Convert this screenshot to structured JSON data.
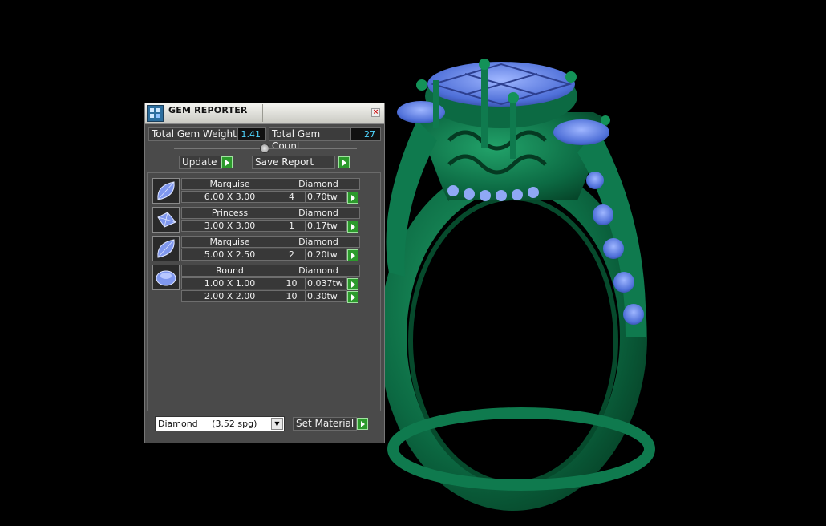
{
  "panel": {
    "title": "GEM REPORTER",
    "close_label": "×",
    "total_gem_weight_label": "Total Gem Weight",
    "total_gem_weight_value": "1.41",
    "total_gem_count_label": "Total Gem Count",
    "total_gem_count_value": "27",
    "update_label": "Update",
    "save_report_label": "Save Report",
    "gems": [
      {
        "shape": "Marquise",
        "material": "Diamond",
        "rows": [
          {
            "size": "6.00 X 3.00",
            "count": "4",
            "weight": "0.70tw"
          }
        ]
      },
      {
        "shape": "Princess",
        "material": "Diamond",
        "rows": [
          {
            "size": "3.00 X 3.00",
            "count": "1",
            "weight": "0.17tw"
          }
        ]
      },
      {
        "shape": "Marquise",
        "material": "Diamond",
        "rows": [
          {
            "size": "5.00 X 2.50",
            "count": "2",
            "weight": "0.20tw"
          }
        ]
      },
      {
        "shape": "Round",
        "material": "Diamond",
        "rows": [
          {
            "size": "1.00 X 1.00",
            "count": "10",
            "weight": "0.037tw"
          },
          {
            "size": "2.00 X 2.00",
            "count": "10",
            "weight": "0.30tw"
          }
        ]
      }
    ],
    "material_select_value": "Diamond     (3.52 spg)",
    "set_material_label": "Set Material"
  },
  "colors": {
    "ring_green": "#0f7a4e",
    "gem_blue": "#5b7fe0",
    "accent_value": "#4fd6ff",
    "go_button": "#2c9a2c"
  }
}
